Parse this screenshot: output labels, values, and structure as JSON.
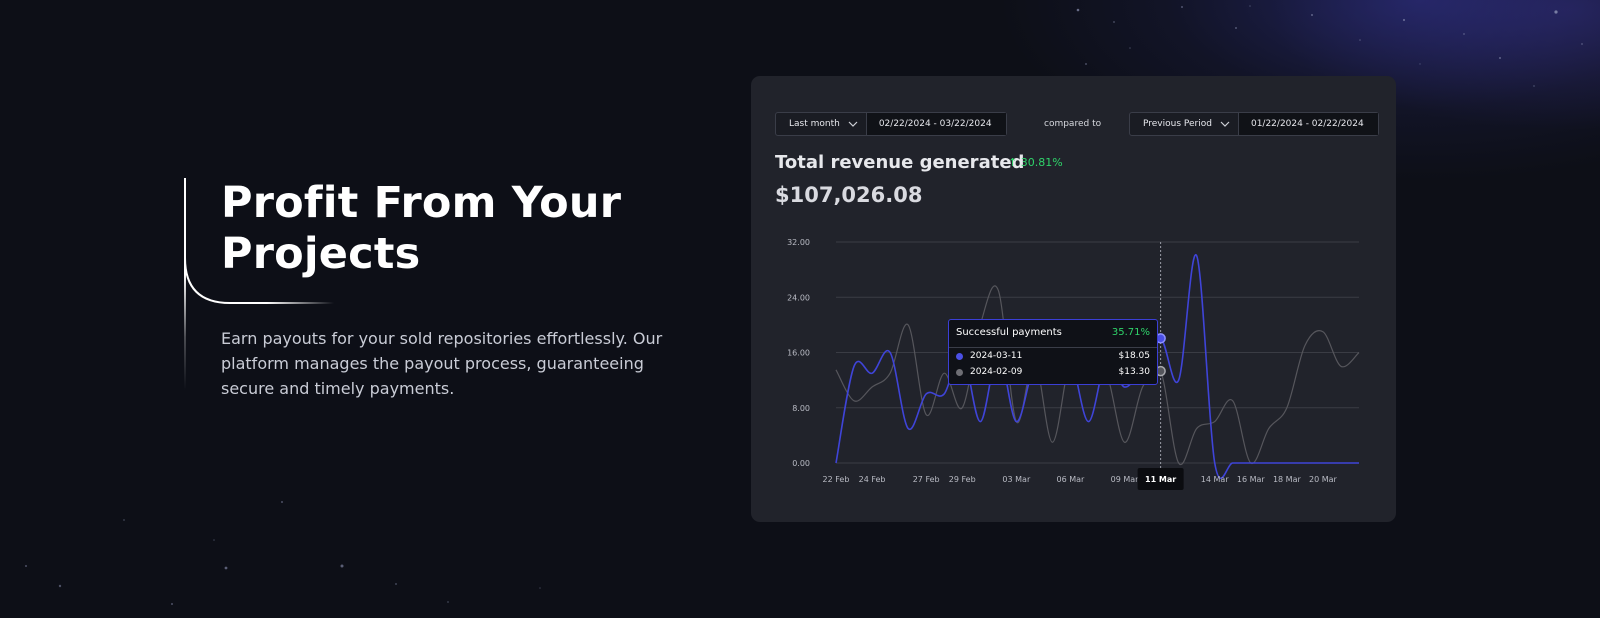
{
  "hero": {
    "title": "Profit From Your Projects",
    "description": "Earn payouts for your sold repositories effortlessly. Our platform manages the payout process, guaranteeing secure and timely payments."
  },
  "filters": {
    "period_select": "Last month",
    "period_range": "02/22/2024 - 03/22/2024",
    "compared_to": "compared to",
    "compare_select": "Previous Period",
    "compare_range": "01/22/2024 - 02/22/2024"
  },
  "revenue": {
    "title": "Total revenue generated",
    "change_arrow": "↑",
    "change": "30.81%",
    "amount": "$107,026.08"
  },
  "tooltip": {
    "title": "Successful payments",
    "change": "35.71%",
    "rows": [
      {
        "date": "2024-03-11",
        "value": "$18.05",
        "color": "#4b50e6"
      },
      {
        "date": "2024-02-09",
        "value": "$13.30",
        "color": "#6e6e74"
      }
    ]
  },
  "colors": {
    "current": "#3f44d8",
    "previous": "#56565c",
    "accent_green": "#2fd36a"
  },
  "chart_data": {
    "type": "line",
    "ylim": [
      0,
      32
    ],
    "yticks": [
      "0.00",
      "8.00",
      "16.00",
      "24.00",
      "32.00"
    ],
    "xtick_labels": [
      "22 Feb",
      "24 Feb",
      "27 Feb",
      "29 Feb",
      "03 Mar",
      "06 Mar",
      "09 Mar",
      "11 Mar",
      "14 Mar",
      "16 Mar",
      "18 Mar",
      "20 Mar"
    ],
    "xtick_index": [
      0,
      2,
      5,
      7,
      10,
      13,
      16,
      18,
      21,
      23,
      25,
      27
    ],
    "highlight_index": 18,
    "highlight_label": "11 Mar",
    "series": [
      {
        "values": [
          0,
          14,
          13,
          16,
          5,
          10,
          10,
          16,
          6,
          16,
          6,
          14,
          13,
          15,
          6,
          15,
          11,
          14,
          18.05,
          12,
          30,
          0,
          0,
          0,
          0,
          0,
          0,
          0,
          0,
          0
        ]
      },
      {
        "values": [
          13.5,
          9,
          11,
          13,
          20,
          7,
          13,
          8,
          20,
          25,
          6,
          15,
          3,
          15,
          14,
          13,
          3,
          11,
          13.3,
          0,
          5,
          6,
          9,
          0,
          5,
          8,
          17,
          19,
          14,
          16
        ]
      }
    ]
  }
}
